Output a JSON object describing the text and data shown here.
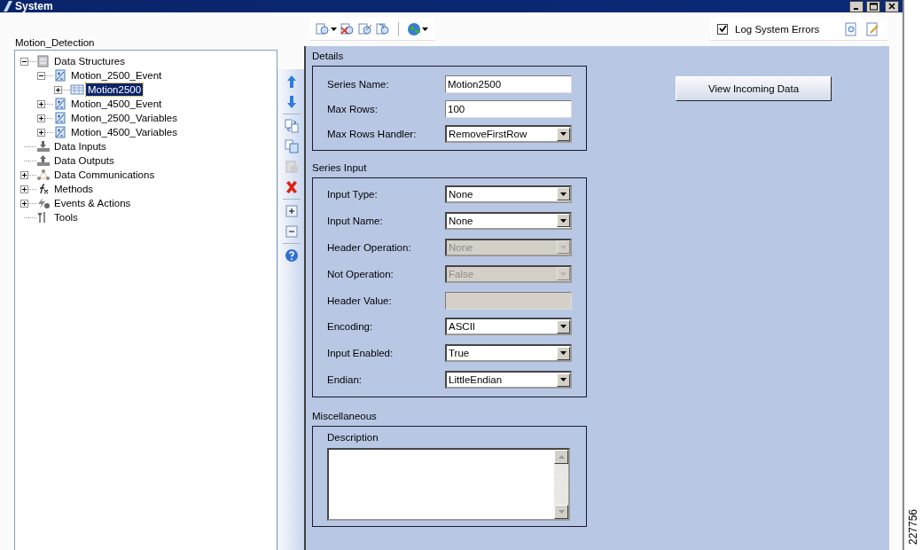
{
  "window": {
    "title": "System"
  },
  "project": {
    "name": "Motion_Detection"
  },
  "tree": [
    {
      "label": "Data Structures",
      "kind": "structures",
      "expanded": true,
      "selected": false,
      "children": [
        {
          "label": "Motion_2500_Event",
          "kind": "event",
          "expanded": true,
          "selected": false,
          "children": [
            {
              "label": "Motion2500",
              "kind": "table",
              "expanded": false,
              "selected": true
            }
          ]
        },
        {
          "label": "Motion_4500_Event",
          "kind": "event",
          "expanded": false,
          "selected": false
        },
        {
          "label": "Motion_2500_Variables",
          "kind": "event",
          "expanded": false,
          "selected": false
        },
        {
          "label": "Motion_4500_Variables",
          "kind": "event",
          "expanded": false,
          "selected": false
        }
      ]
    },
    {
      "label": "Data Inputs",
      "kind": "inputs",
      "selected": false
    },
    {
      "label": "Data Outputs",
      "kind": "outputs",
      "selected": false
    },
    {
      "label": "Data Communications",
      "kind": "communications",
      "expanded": false,
      "selected": false
    },
    {
      "label": "Methods",
      "kind": "methods",
      "expanded": false,
      "selected": false
    },
    {
      "label": "Events & Actions",
      "kind": "events",
      "expanded": false,
      "selected": false
    },
    {
      "label": "Tools",
      "kind": "tools",
      "selected": false
    }
  ],
  "log_system_errors": {
    "label": "Log System Errors",
    "checked": true
  },
  "details": {
    "title": "Details",
    "fields": [
      {
        "label": "Series Name:",
        "kind": "text",
        "value": "Motion2500",
        "disabled": false
      },
      {
        "label": "Max Rows:",
        "kind": "text",
        "value": "100",
        "disabled": false
      },
      {
        "label": "Max Rows Handler:",
        "kind": "select",
        "value": "RemoveFirstRow",
        "disabled": false
      }
    ]
  },
  "series_input": {
    "title": "Series Input",
    "fields": [
      {
        "label": "Input Type:",
        "kind": "select",
        "value": "None",
        "disabled": false
      },
      {
        "label": "Input Name:",
        "kind": "select",
        "value": "None",
        "disabled": false
      },
      {
        "label": "Header Operation:",
        "kind": "select",
        "value": "None",
        "disabled": true
      },
      {
        "label": "Not Operation:",
        "kind": "select",
        "value": "False",
        "disabled": true
      },
      {
        "label": "Header Value:",
        "kind": "text",
        "disabled": true
      },
      {
        "label": "Encoding:",
        "kind": "select",
        "value": "ASCII",
        "disabled": false
      },
      {
        "label": "Input Enabled:",
        "kind": "select",
        "value": "True",
        "disabled": false
      },
      {
        "label": "Endian:",
        "kind": "select",
        "value": "LittleEndian",
        "disabled": false
      }
    ]
  },
  "miscellaneous": {
    "title": "Miscellaneous",
    "description_label": "Description"
  },
  "view_button": "View Incoming Data",
  "figure_number": "227756"
}
